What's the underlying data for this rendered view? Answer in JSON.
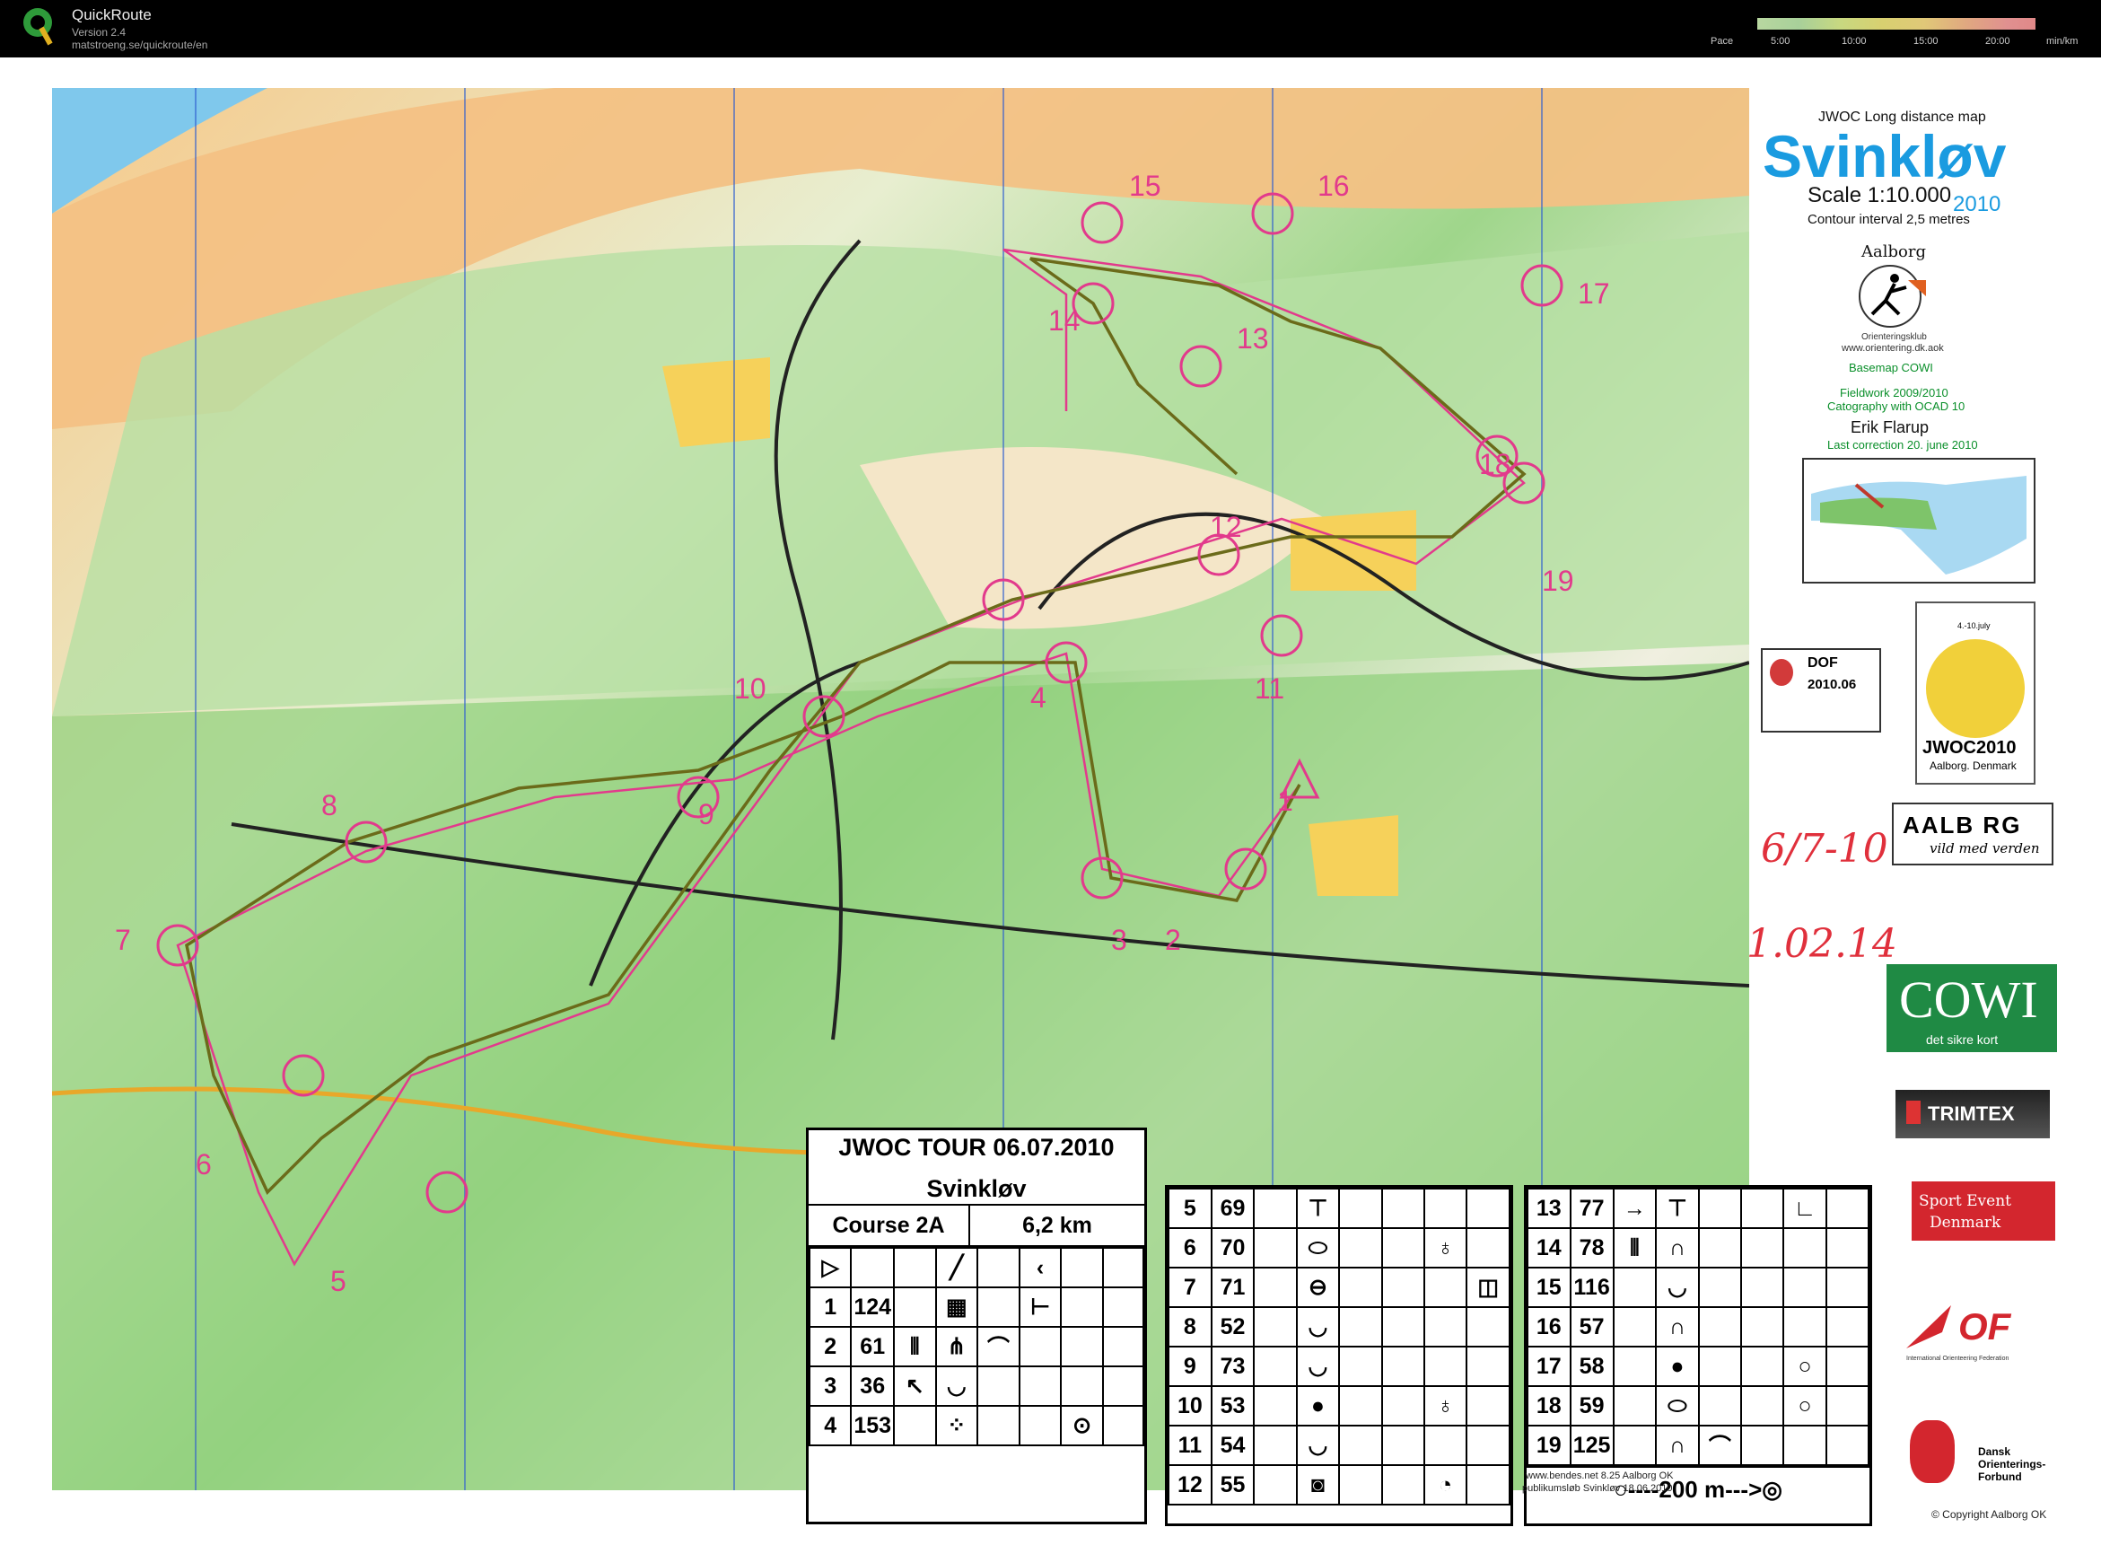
{
  "app": {
    "name": "QuickRoute",
    "version": "Version 2.4",
    "url": "matstroeng.se/quickroute/en"
  },
  "pace": {
    "label": "Pace",
    "ticks": [
      "5:00",
      "10:00",
      "15:00",
      "20:00"
    ],
    "unit": "min/km"
  },
  "legend": {
    "heading": "JWOC  Long distance map",
    "name": "Svinkløv",
    "scale": "Scale  1:10.000",
    "year": "2010",
    "contour": "Contour interval  2,5 metres",
    "club_top": "Aalborg",
    "club_bottom": "Orienteringsklub",
    "club_url": "www.orientering.dk.aok",
    "basemap": "Basemap  COWI",
    "fieldwork": "Fieldwork  2009/2010",
    "cartography": "Catography with  OCAD 10",
    "author": "Erik Flarup",
    "last_correction": "Last correction  20. june 2010"
  },
  "handwritten": {
    "date": "6/7-10",
    "time": "1.02.14"
  },
  "logos": {
    "dof_title": "DOF",
    "dof_year": "2010.06",
    "jwoc_dates": "4.-10.july",
    "jwoc_name": "JWOC2010",
    "jwoc_place": "Aalborg. Denmark",
    "aalborg": "AALB RG",
    "aalborg_tag": "vild med verden",
    "cowi": "COWI",
    "cowi_tag": "det sikre kort",
    "trimtex": "TRIMTEX",
    "sportevent_1": "Sport Event",
    "sportevent_2": "Denmark",
    "iof": "OF",
    "iof_text": "International Orienteering Federation",
    "dansk_1": "Dansk",
    "dansk_2": "Orienterings-",
    "dansk_3": "Forbund",
    "copyright": "© Copyright  Aalborg OK"
  },
  "control_labels": [
    "1",
    "2",
    "3",
    "4",
    "5",
    "6",
    "7",
    "8",
    "9",
    "10",
    "11",
    "12",
    "13",
    "14",
    "15",
    "16",
    "17",
    "18",
    "19"
  ],
  "description": {
    "title": "JWOC TOUR 06.07.2010",
    "subtitle": "Svinkløv",
    "course": "Course 2A",
    "length": "6,2 km",
    "rows_a": [
      [
        "1",
        "124"
      ],
      [
        "2",
        "61"
      ],
      [
        "3",
        "36"
      ],
      [
        "4",
        "153"
      ]
    ],
    "rows_b": [
      [
        "5",
        "69"
      ],
      [
        "6",
        "70"
      ],
      [
        "7",
        "71"
      ],
      [
        "8",
        "52"
      ],
      [
        "9",
        "73"
      ],
      [
        "10",
        "53"
      ],
      [
        "11",
        "54"
      ],
      [
        "12",
        "55"
      ]
    ],
    "rows_c": [
      [
        "13",
        "77"
      ],
      [
        "14",
        "78"
      ],
      [
        "15",
        "116"
      ],
      [
        "16",
        "57"
      ],
      [
        "17",
        "58"
      ],
      [
        "18",
        "59"
      ],
      [
        "19",
        "125"
      ]
    ],
    "finish": "○----200 m--->◎"
  },
  "footer": {
    "line1": "www.bendes.net 8.25  Aalborg OK",
    "line2": "publikumsløb Svinkløv 18.06 2010"
  }
}
